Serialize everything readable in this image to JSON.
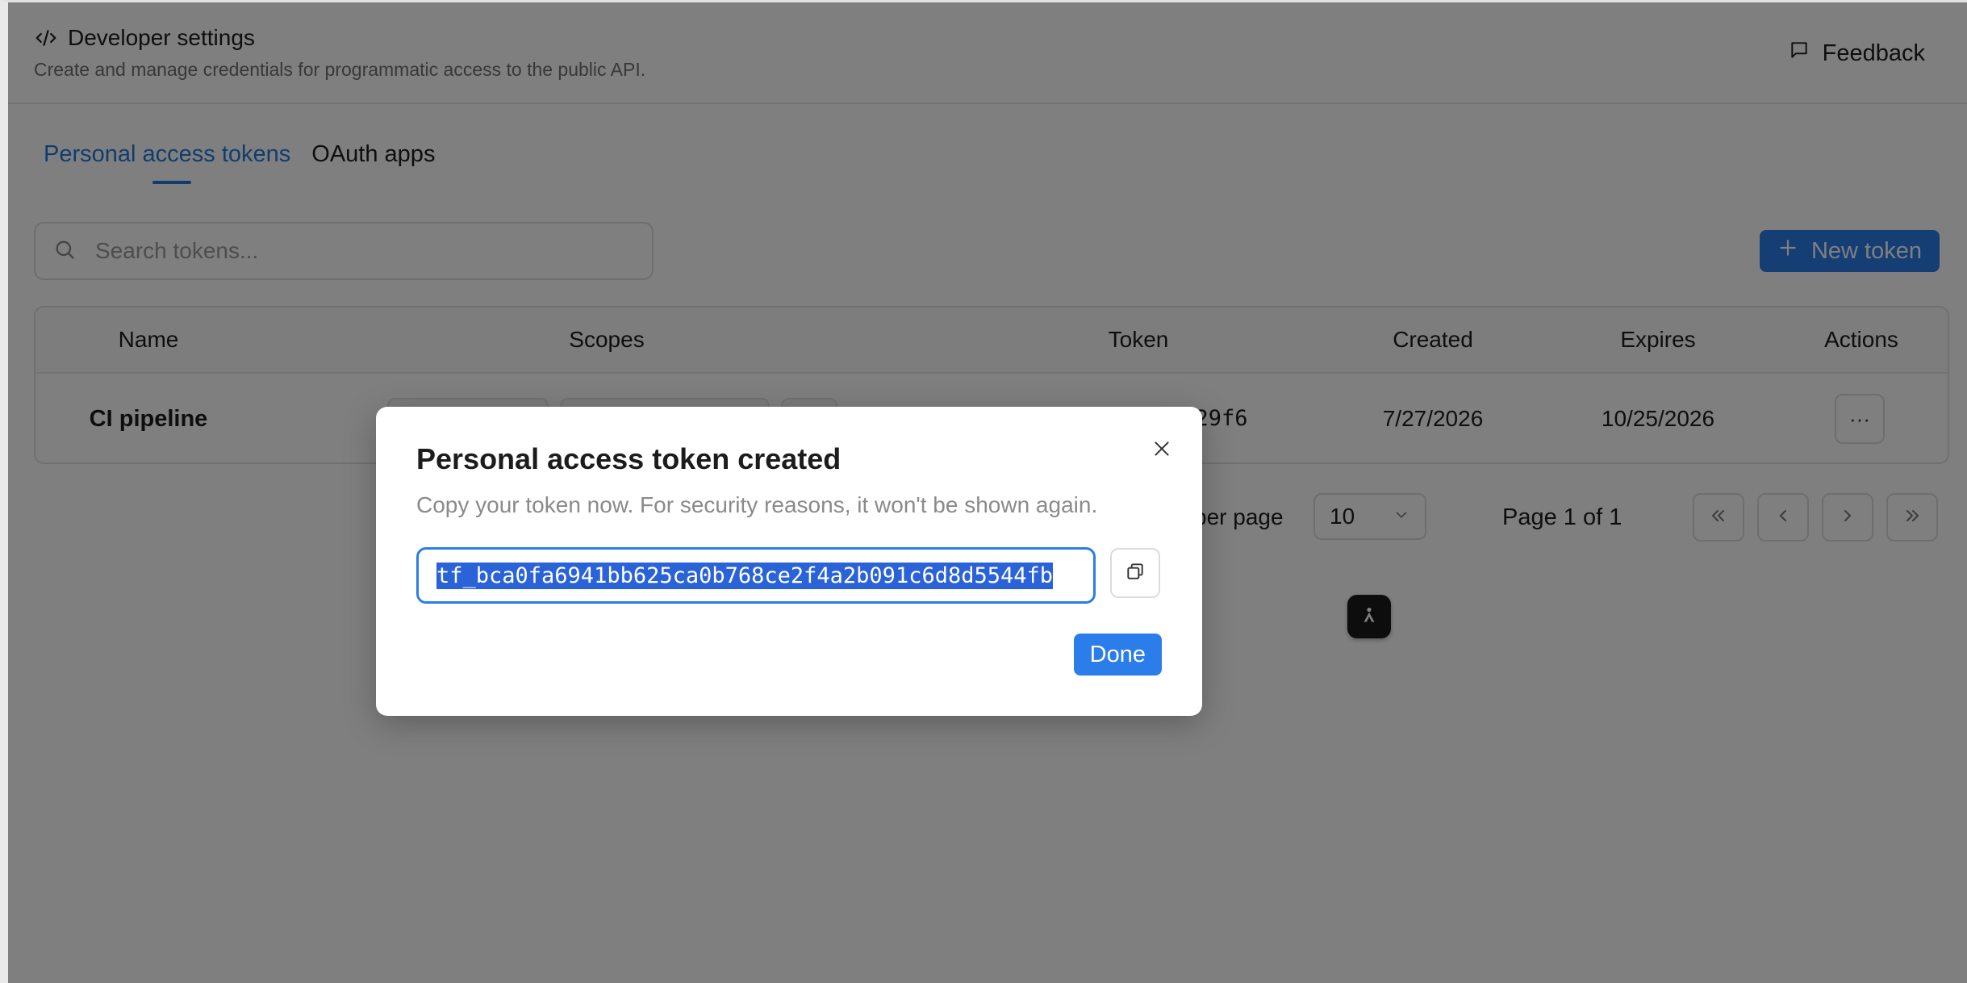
{
  "header": {
    "title": "Developer settings",
    "subtitle": "Create and manage credentials for programmatic access to the public API.",
    "feedback_label": "Feedback",
    "title_icon": "code-icon",
    "feedback_icon": "message-square-icon"
  },
  "tabs": [
    {
      "label": "Personal access tokens",
      "active": true
    },
    {
      "label": "OAuth apps",
      "active": false
    }
  ],
  "search": {
    "placeholder": "Search tokens...",
    "value": ""
  },
  "new_token_label": "New token",
  "table": {
    "columns": [
      "Name",
      "Scopes",
      "Token",
      "Created",
      "Expires",
      "Actions"
    ],
    "rows": [
      {
        "name": "CI pipeline",
        "token": "29f6",
        "created": "7/27/2026",
        "expires": "10/25/2026",
        "actions": "···"
      }
    ]
  },
  "pagination": {
    "rows_label": "per page",
    "rows_value": "10",
    "page_label": "Page 1 of 1"
  },
  "modal": {
    "title": "Personal access token created",
    "description": "Copy your token now. For security reasons, it won't be shown again.",
    "token": "tf_bca0fa6941bb625ca0b768ce2f4a2b091c6d8d5544fb",
    "done_label": "Done"
  },
  "colors": {
    "accent": "#2b7de9",
    "tab_active": "#1f7bdc",
    "selection": "#2a62d8"
  }
}
